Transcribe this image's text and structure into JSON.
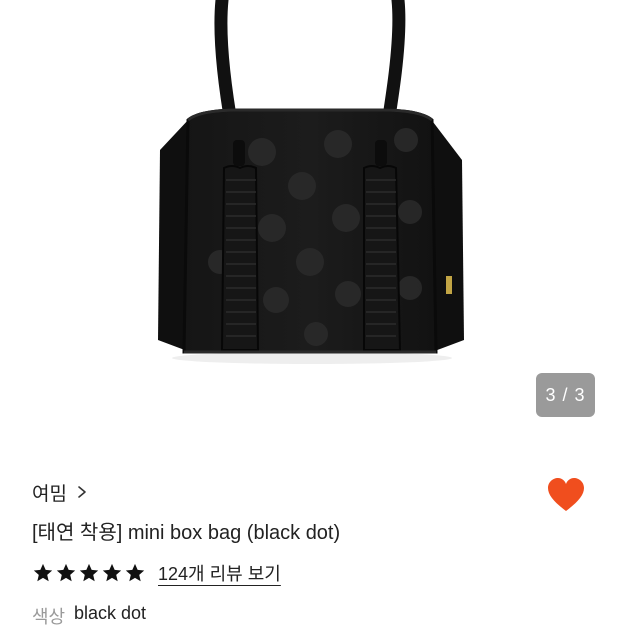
{
  "gallery": {
    "page_indicator": "3 / 3",
    "image": "black-dot-mini-box-bag-photo"
  },
  "product": {
    "brand": "여밈",
    "title": "[태연 착용] mini box bag (black dot)",
    "rating_stars": 5,
    "review_link": "124개 리뷰 보기",
    "wishlist_icon": "heart-icon",
    "accent_color": "#F04E1E",
    "option": {
      "label": "색상",
      "value": "black dot"
    }
  }
}
